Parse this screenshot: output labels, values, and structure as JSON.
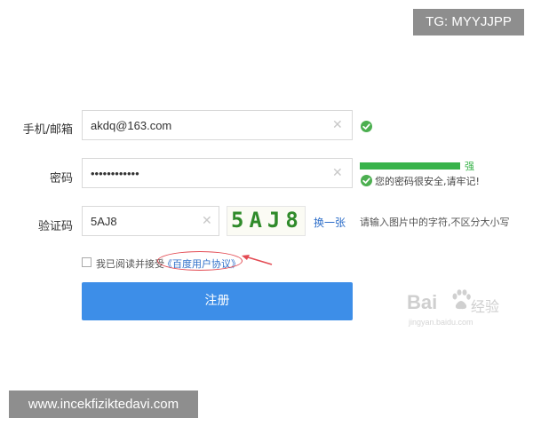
{
  "watermark": {
    "tag": "TG: MYYJJPP",
    "url": "www.incekfiziktedavi.com"
  },
  "form": {
    "email": {
      "label": "手机/邮箱",
      "value": "akdq@163.com"
    },
    "password": {
      "label": "密码",
      "value": "••••••••••••",
      "strength_label": "强",
      "strength_level": 1.0,
      "hint": "您的密码很安全,请牢记!"
    },
    "captcha": {
      "label": "验证码",
      "value": "5AJ8",
      "image_text": "5AJ8",
      "refresh": "换一张",
      "hint": "请输入图片中的字符,不区分大小写"
    },
    "agree": {
      "prefix": "我已阅读并接受",
      "link": "《百度用户协议》"
    },
    "submit": "注册"
  },
  "branding": {
    "logo_main": "Bai",
    "logo_side": "经验",
    "logo_sub": "jingyan.baidu.com"
  },
  "colors": {
    "accent": "#3d8ee8",
    "success": "#38b34a",
    "link": "#2f6fc9",
    "annotation": "#e34a52"
  },
  "icons": [
    "clear-icon",
    "check-circle-icon",
    "annotation-arrow-icon",
    "paw-icon"
  ]
}
